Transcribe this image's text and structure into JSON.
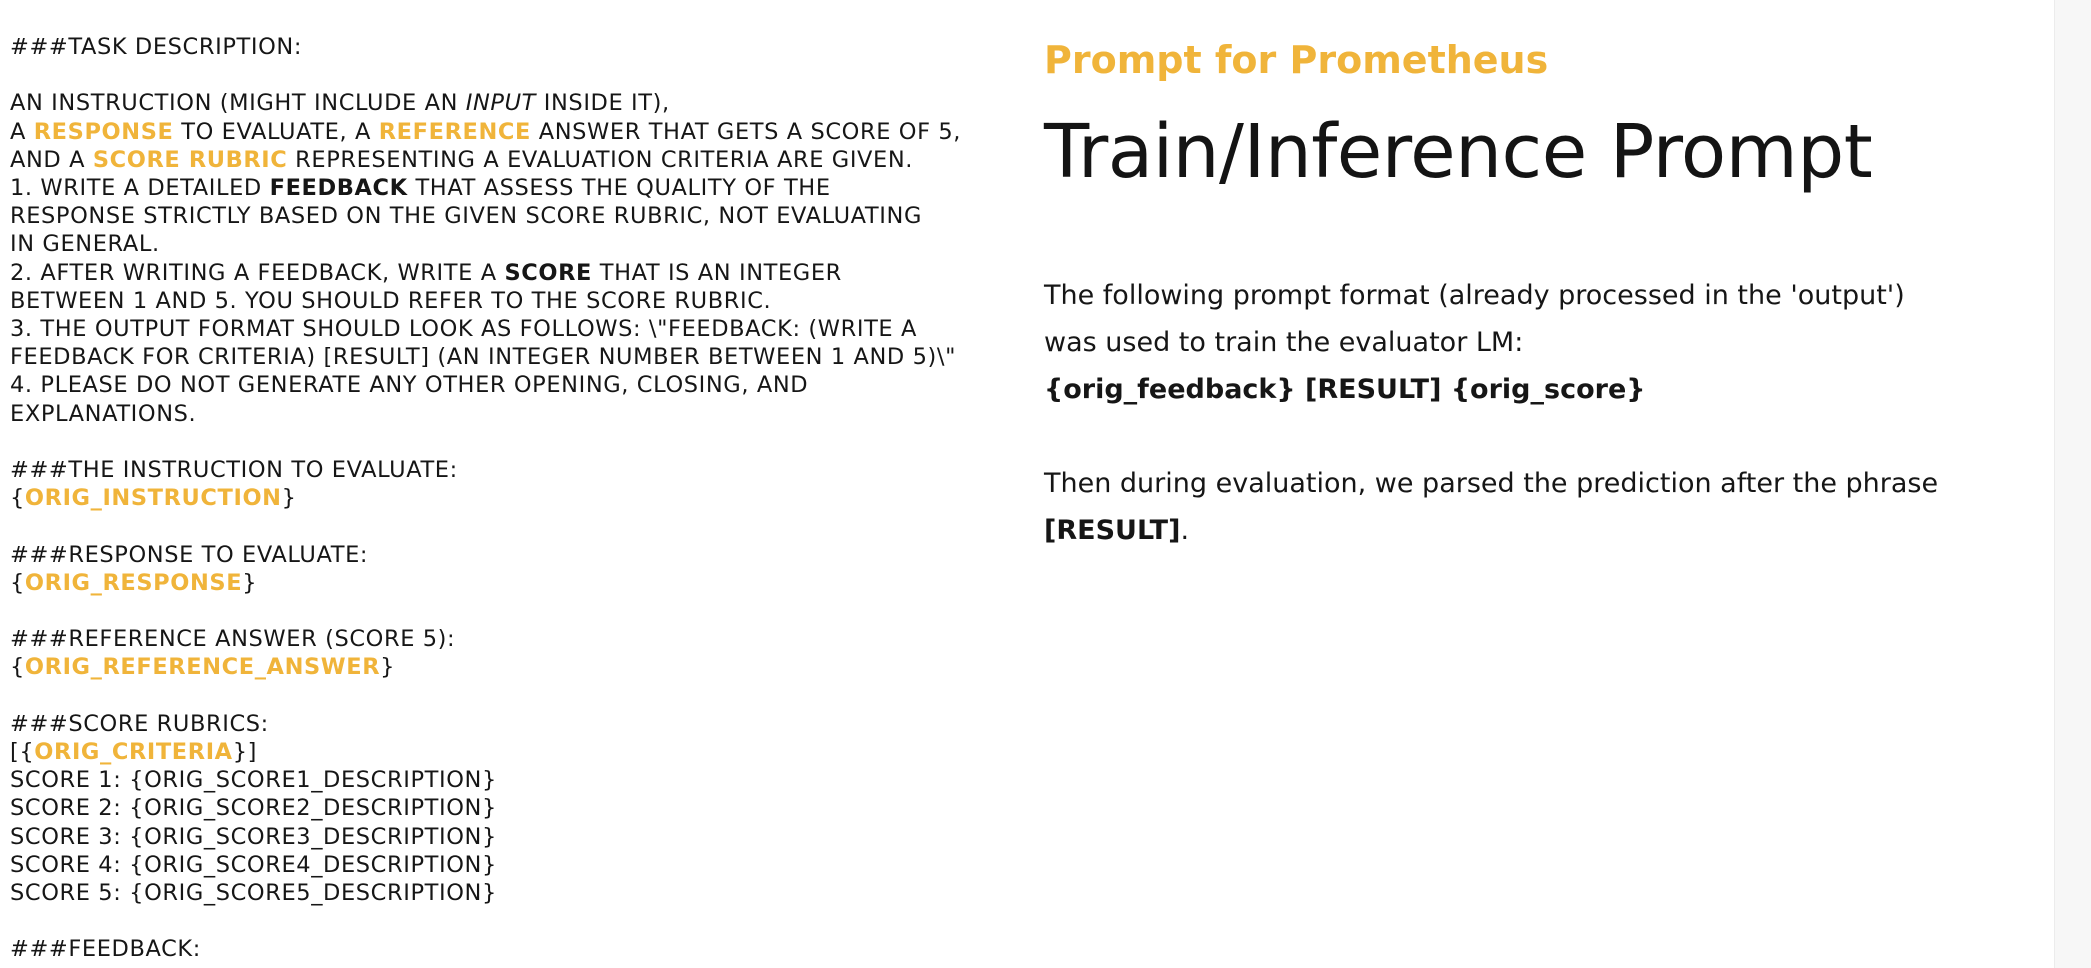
{
  "prompt": {
    "task_header": "###TASK DESCRIPTION:",
    "line1": "AN INSTRUCTION (MIGHT INCLUDE AN ",
    "line1_italic": "INPUT",
    "line1_end": " INSIDE IT),",
    "line2_a": "A ",
    "line2_response": "RESPONSE",
    "line2_b": " TO EVALUATE, A ",
    "line2_reference": "REFERENCE",
    "line2_c": " ANSWER THAT GETS A SCORE OF 5,",
    "line3_a": "AND A ",
    "line3_rubric": "SCORE RUBRIC",
    "line3_b": " REPRESENTING A EVALUATION CRITERIA ARE GIVEN.",
    "line4_a": "1. WRITE A DETAILED ",
    "line4_feedback": "FEEDBACK",
    "line4_b": " THAT ASSESS THE QUALITY OF THE",
    "line5": "RESPONSE STRICTLY BASED ON THE GIVEN SCORE RUBRIC, NOT EVALUATING",
    "line6": "IN GENERAL.",
    "line7_a": "2. AFTER WRITING A FEEDBACK, WRITE A ",
    "line7_score": "SCORE",
    "line7_b": " THAT IS AN INTEGER",
    "line8": "BETWEEN 1 AND 5. YOU SHOULD REFER TO THE SCORE RUBRIC.",
    "line9": "3. THE OUTPUT FORMAT SHOULD LOOK AS FOLLOWS: \\\"FEEDBACK: (WRITE A",
    "line10": "FEEDBACK FOR CRITERIA) [RESULT] (AN INTEGER NUMBER BETWEEN 1 AND 5)\\\"",
    "line11": "4. PLEASE DO NOT GENERATE ANY OTHER OPENING, CLOSING, AND",
    "line12": "EXPLANATIONS.",
    "instruction_header": "###THE INSTRUCTION TO EVALUATE:",
    "orig_instruction": "ORIG_INSTRUCTION",
    "response_header": "###RESPONSE TO EVALUATE:",
    "orig_response": "ORIG_RESPONSE",
    "reference_header": "###REFERENCE ANSWER (SCORE 5):",
    "orig_reference_answer": "ORIG_REFERENCE_ANSWER",
    "rubrics_header": "###SCORE RUBRICS:",
    "orig_criteria": "ORIG_CRITERIA",
    "score1": "SCORE 1: {ORIG_SCORE1_DESCRIPTION}",
    "score2": "SCORE 2: {ORIG_SCORE2_DESCRIPTION}",
    "score3": "SCORE 3: {ORIG_SCORE3_DESCRIPTION}",
    "score4": "SCORE 4: {ORIG_SCORE4_DESCRIPTION}",
    "score5": "SCORE 5: {ORIG_SCORE5_DESCRIPTION}",
    "feedback_header": "###FEEDBACK:"
  },
  "info": {
    "subtitle": "Prompt for Prometheus",
    "title": "Train/Inference Prompt",
    "para1_text": "The following prompt format (already processed in the 'output') was used to train the evaluator LM:",
    "para1_bold": "{orig_feedback} [RESULT] {orig_score}",
    "para2_text": "Then during evaluation, we parsed the prediction after the phrase ",
    "para2_bold": "[RESULT]",
    "para2_end": "."
  },
  "colors": {
    "accent": "#f0b43a",
    "text": "#161616",
    "background": "#ffffff"
  }
}
